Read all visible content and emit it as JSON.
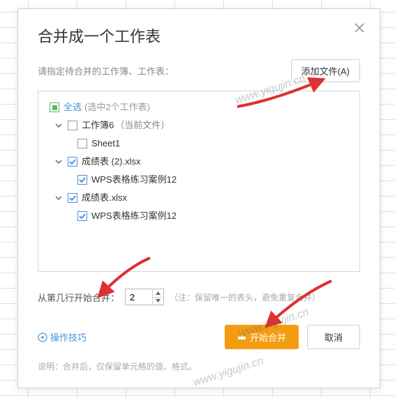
{
  "dialog": {
    "title": "合并成一个工作表",
    "instruction": "请指定待合并的工作簿、工作表：",
    "add_file_label": "添加文件(A)"
  },
  "tree": {
    "select_all": {
      "label": "全选",
      "hint": "(选中2个工作表)"
    },
    "items": [
      {
        "label": "工作簿6",
        "suffix": "（当前文件）",
        "checked": false,
        "children": [
          {
            "label": "Sheet1",
            "checked": false
          }
        ]
      },
      {
        "label": "成绩表 (2).xlsx",
        "checked": true,
        "children": [
          {
            "label": "WPS表格练习案例12",
            "checked": true
          }
        ]
      },
      {
        "label": "成绩表.xlsx",
        "checked": true,
        "children": [
          {
            "label": "WPS表格练习案例12",
            "checked": true
          }
        ]
      }
    ]
  },
  "start_row": {
    "label": "从第几行开始合并：",
    "value": "2",
    "hint": "（注：保留唯一的表头，避免重复合并）"
  },
  "footer": {
    "tips_label": "操作技巧",
    "merge_label": "开始合并",
    "cancel_label": "取消"
  },
  "note": "说明：合并后，仅保留单元格的值、格式。",
  "watermark": "www.yigujin.cn"
}
